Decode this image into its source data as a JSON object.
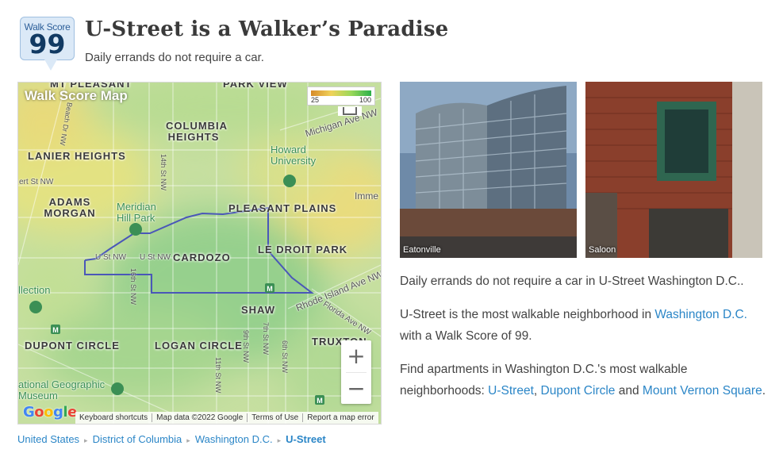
{
  "badge": {
    "label": "Walk Score",
    "score": "99"
  },
  "header": {
    "title": "U-Street is a Walker’s Paradise",
    "subtitle": "Daily errands do not require a car."
  },
  "map": {
    "title": "Walk Score Map",
    "legend": {
      "low": "25",
      "high": "100"
    },
    "neighborhoods": {
      "mt_pleasant": "MT PLEASANT",
      "columbia_heights": "COLUMBIA HEIGHTS",
      "lanier_heights": "LANIER HEIGHTS",
      "adams_morgan": "ADAMS MORGAN",
      "pleasant_plains": "PLEASANT PLAINS",
      "cardozo": "CARDOZO",
      "le_droit_park": "LE DROIT PARK",
      "shaw": "SHAW",
      "dupont_circle": "DUPONT CIRCLE",
      "logan_circle": "LOGAN CIRCLE",
      "truxton": "TRUXTON",
      "park_view": "PARK VIEW"
    },
    "places": {
      "howard": "Howard University",
      "meridian": "Meridian Hill Park",
      "natgeo": "ational Geographic Museum",
      "imme": "Imme",
      "illection": "llection"
    },
    "streets": {
      "michigan": "Michigan Ave NW",
      "rhode_island": "Rhode Island Ave NW",
      "florida": "Florida Ave NW",
      "u_st_1": "U St NW",
      "u_st_2": "U St NW",
      "st_14": "14th St NW",
      "st_16": "16th St NW",
      "st_11": "11th St NW",
      "st_9": "9th St NW",
      "st_7": "7th St NW",
      "st_6": "6th St NW",
      "ert_st": "ert St NW",
      "beach_dr": "Beach Dr NW"
    },
    "zoom_in": "+",
    "zoom_out": "−",
    "google": "Google",
    "attribution": [
      "Keyboard shortcuts",
      "Map data ©2022 Google",
      "Terms of Use",
      "Report a map error"
    ]
  },
  "photos": [
    {
      "caption": "Eatonville"
    },
    {
      "caption": "Saloon"
    }
  ],
  "text": {
    "p1": "Daily errands do not require a car in U-Street Washington D.C..",
    "p2_a": "U-Street is the most walkable neighborhood in ",
    "p2_link": "Washington D.C.",
    "p2_b": " with a Walk Score of 99.",
    "p3_a": "Find apartments in Washington D.C.'s most walkable neighborhoods: ",
    "p3_link1": "U-Street",
    "p3_sep1": ", ",
    "p3_link2": "Dupont Circle",
    "p3_and": " and ",
    "p3_link3": "Mount Vernon Square",
    "p3_end": "."
  },
  "breadcrumb": {
    "items": [
      "United States",
      "District of Columbia",
      "Washington D.C."
    ],
    "current": "U-Street",
    "separator": "▸"
  },
  "colors": {
    "link": "#2b86c7",
    "badge_bg": "#dbe9f7",
    "badge_text": "#113a63",
    "outline": "#4a57b8"
  }
}
